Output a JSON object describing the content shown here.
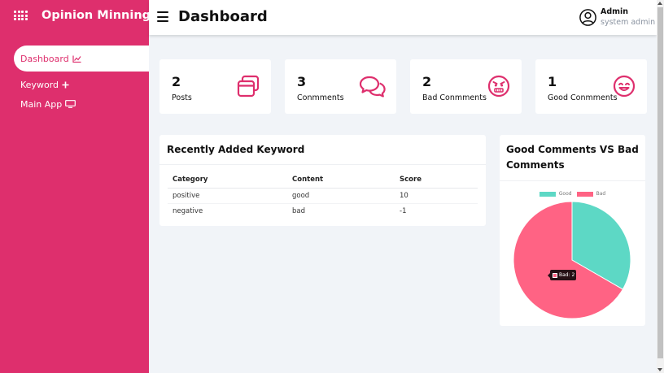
{
  "app": {
    "title": "Opinion Minning",
    "brand_icon": "grid-dots-icon"
  },
  "sidebar": {
    "items": [
      {
        "label": "Dashboard",
        "icon": "line-chart-icon",
        "active": true
      },
      {
        "label": "Keyword",
        "icon": "plus-icon",
        "active": false
      },
      {
        "label": "Main App",
        "icon": "monitor-icon",
        "active": false
      }
    ]
  },
  "header": {
    "menu_icon": "hamburger-icon",
    "title": "Dashboard",
    "user": {
      "name": "Admin",
      "role": "system admin",
      "icon": "user-circle-icon"
    }
  },
  "cards": [
    {
      "value": "2",
      "label": "Posts",
      "icon": "windows-icon"
    },
    {
      "value": "3",
      "label": "Conmments",
      "icon": "chat-bubbles-icon"
    },
    {
      "value": "2",
      "label": "Bad Conmments",
      "icon": "angry-face-icon"
    },
    {
      "value": "1",
      "label": "Good Conmments",
      "icon": "smile-face-icon"
    }
  ],
  "keywords": {
    "title": "Recently Added Keyword",
    "columns": [
      "Category",
      "Content",
      "Score"
    ],
    "rows": [
      [
        "positive",
        "good",
        "10"
      ],
      [
        "negative",
        "bad",
        "-1"
      ]
    ]
  },
  "chart_panel": {
    "title": "Good Comments VS Bad Comments",
    "tooltip": "Bad: 2"
  },
  "colors": {
    "brand": "#de2f6d",
    "good": "#5dd8c5",
    "bad": "#ff6384"
  },
  "chart_data": {
    "type": "pie",
    "categories": [
      "Good",
      "Bad"
    ],
    "values": [
      1,
      2
    ],
    "legend": "top",
    "colors": [
      "#5dd8c5",
      "#ff6384"
    ]
  }
}
